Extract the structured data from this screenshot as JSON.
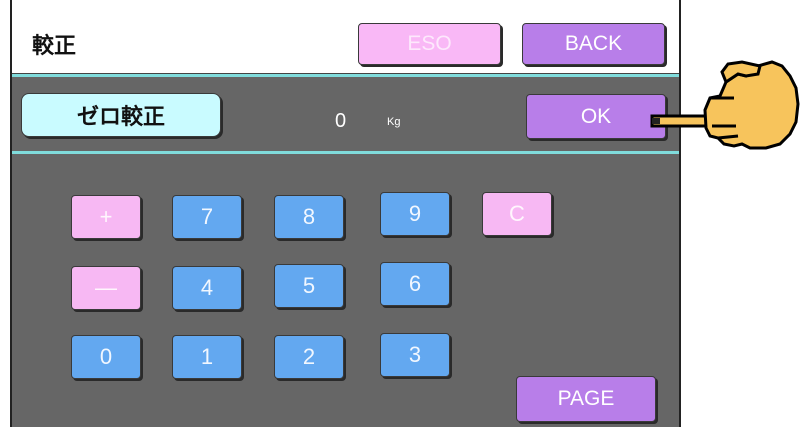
{
  "header": {
    "title": "較正",
    "eso_label": "ESO",
    "back_label": "BACK"
  },
  "calib": {
    "zero_label": "ゼロ較正",
    "value": "0",
    "unit": "Kg",
    "ok_label": "OK"
  },
  "keypad": {
    "plus": "+",
    "minus": "—",
    "clear": "C",
    "digits": [
      "0",
      "1",
      "2",
      "3",
      "4",
      "5",
      "6",
      "7",
      "8",
      "9"
    ],
    "page_label": "PAGE"
  }
}
